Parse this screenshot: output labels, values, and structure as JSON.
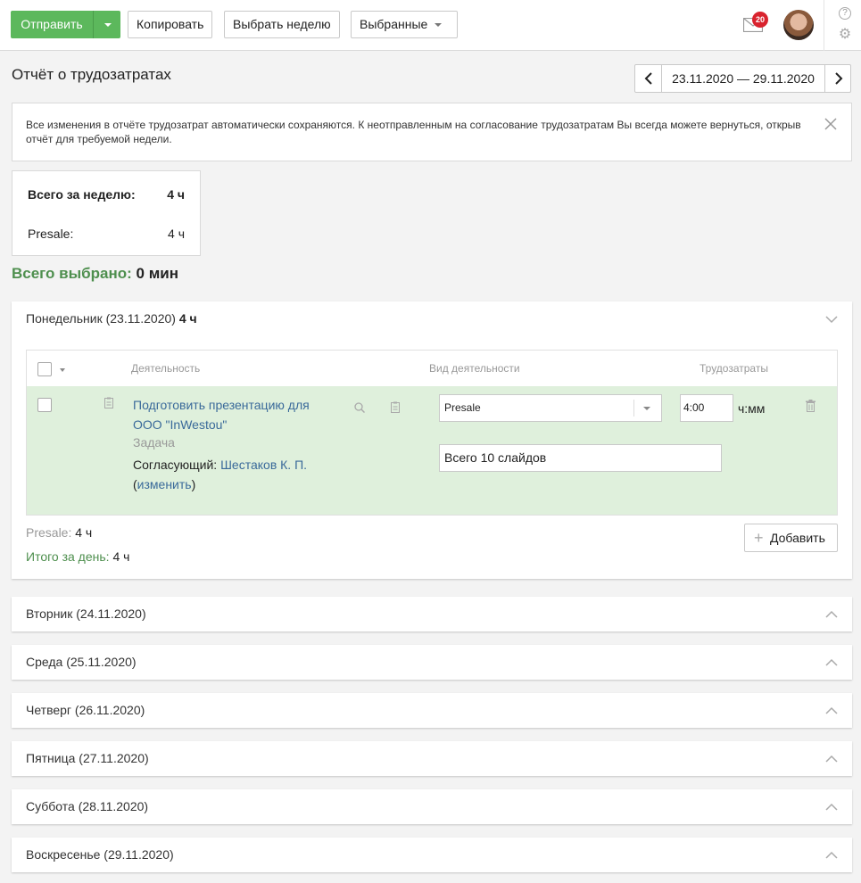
{
  "toolbar": {
    "send_label": "Отправить",
    "copy_label": "Копировать",
    "select_week_label": "Выбрать неделю",
    "selected_label": "Выбранные",
    "notifications_count": "20"
  },
  "header": {
    "title": "Отчёт о трудозатратах",
    "date_range": "23.11.2020 — 29.11.2020"
  },
  "notice": {
    "text": "Все изменения в отчёте трудозатрат автоматически сохраняются. К неотправленным на согласование трудозатратам Вы всегда можете вернуться, открыв отчёт для требуемой недели."
  },
  "week_totals": {
    "total_label": "Всего за неделю:",
    "total_value": "4 ч",
    "items": [
      {
        "label": "Presale:",
        "value": "4 ч"
      }
    ]
  },
  "selected_total": {
    "label": "Всего выбрано:",
    "value": "0 мин"
  },
  "days": [
    {
      "label": "Понедельник (23.11.2020)",
      "hours": "4 ч",
      "expanded": true,
      "table": {
        "col_activity": "Деятельность",
        "col_activity_type": "Вид деятельности",
        "col_effort": "Трудозатраты"
      },
      "task": {
        "title": "Подготовить презентацию для ООО \"InWestou\"",
        "type": "Задача",
        "approver_label": "Согласующий:",
        "approver_name": "Шестаков К. П.",
        "change_open": "(",
        "change_link": "изменить",
        "change_close": ")",
        "activity_type": "Presale",
        "time": "4:00",
        "time_unit": "ч:мм",
        "comment": "Всего 10 слайдов"
      },
      "summary": {
        "type_label": "Presale:",
        "type_value": "4 ч",
        "day_label": "Итого за день:",
        "day_value": "4 ч"
      },
      "add_label": "Добавить"
    },
    {
      "label": "Вторник (24.11.2020)",
      "expanded": false
    },
    {
      "label": "Среда (25.11.2020)",
      "expanded": false
    },
    {
      "label": "Четверг (26.11.2020)",
      "expanded": false
    },
    {
      "label": "Пятница (27.11.2020)",
      "expanded": false
    },
    {
      "label": "Суббота (28.11.2020)",
      "expanded": false
    },
    {
      "label": "Воскресенье (29.11.2020)",
      "expanded": false
    }
  ],
  "colors": {
    "accent_green": "#5cb85c",
    "row_highlight": "#dff0dc",
    "link_blue": "#3a6a9a",
    "badge_red": "#d9232e"
  },
  "icons": [
    "caret-down-icon",
    "mail-icon",
    "help-icon",
    "gear-icon",
    "chevron-left-icon",
    "chevron-right-icon",
    "close-icon",
    "clipboard-icon",
    "search-icon",
    "trash-icon",
    "plus-icon",
    "chevron-up-icon",
    "chevron-down-icon"
  ]
}
